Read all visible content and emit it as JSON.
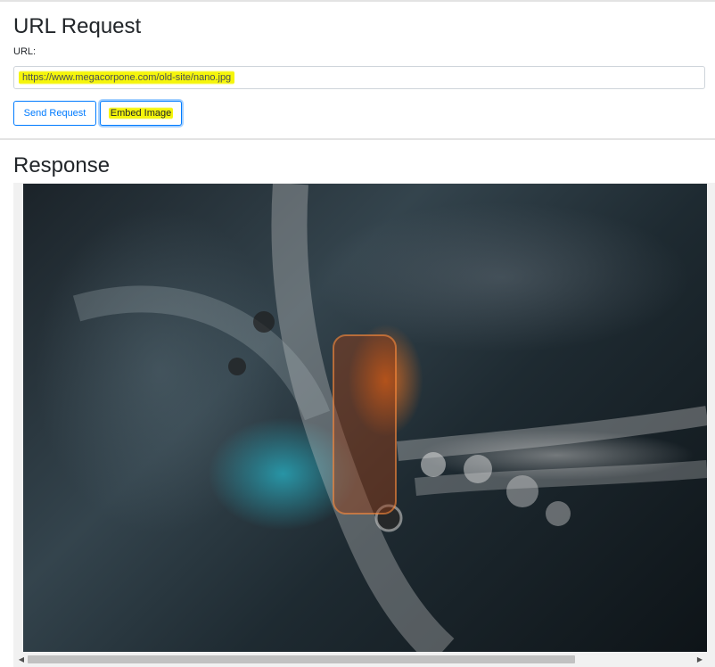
{
  "request": {
    "title": "URL Request",
    "url_label": "URL:",
    "url_value": "https://www.megacorpone.com/old-site/nano.jpg"
  },
  "buttons": {
    "send_label": "Send Request",
    "embed_label": "Embed Image"
  },
  "response": {
    "title": "Response",
    "image_icon": "dna-helix-image"
  },
  "scrollbar": {
    "left_arrow": "◀",
    "right_arrow": "▶",
    "position_fraction": 0.0
  },
  "colors": {
    "accent": "#007bff",
    "highlight": "#f5f50a"
  }
}
